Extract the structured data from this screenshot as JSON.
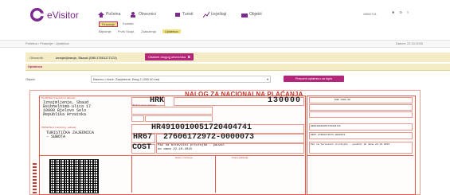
{
  "brand": {
    "name": "eVisitor",
    "color": "#7b2a8f"
  },
  "nav": {
    "items": [
      {
        "label": "Početna",
        "icon": "home-icon"
      },
      {
        "label": "Obveznici",
        "icon": "users-icon"
      },
      {
        "label": "Turisti",
        "icon": "tourist-icon"
      },
      {
        "label": "Izvještaji",
        "icon": "chart-icon"
      },
      {
        "label": "Objekti",
        "icon": "building-icon"
      }
    ],
    "subitems": [
      {
        "label": "Financije",
        "active": true
      },
      {
        "label": "Kontakt",
        "active": false
      }
    ],
    "tertiary": [
      "Biljezinje",
      "Prvih Skupl.",
      "Zaduženja",
      "Uplatnica"
    ],
    "right_code": "OIB/2721"
  },
  "breadcrumb": {
    "text": "Početna › Financije › Uplatnica",
    "right": "Datum: 22.10.2015"
  },
  "tabs": {
    "obveznik_label": "Obveznik:",
    "obveznik_value": "Iznajmljivanje, Sbaud (OIB 27661177172)",
    "change_button": "Odaberi drugog obveznika"
  },
  "section": {
    "title": "Uplatnica"
  },
  "form": {
    "objekt_label": "Objekt:",
    "objekt_value": "Biserno i more, Zavjetrene, Brug 1 (300.00 km)",
    "print_button": "Preuzmi uplatnicu za ispis"
  },
  "nalog": {
    "title": "NALOG ZA NACIONALNA PLAĆANJA",
    "platitelj_label": "PLATITELJ (naziv/ime i adresa):",
    "platitelj_lines": [
      "Iznajmljenje, Sbaud",
      "Bsibnelnima ulica 17",
      "10000 Bjelovo Selo",
      "Republika Hrvatska"
    ],
    "currency": "HRK",
    "amount": "130000",
    "iban_platitelja_label": "IBAN ili račun platitelja",
    "primatelj_label": "PRIMATELJ (naziv/ime i adresa):",
    "primatelj_lines": [
      "TURISTIČKA ZAJEDNICA",
      "- SUBOTA"
    ],
    "iban_primatelja": "HR4910010051720404741",
    "model": "HR67",
    "poziv_na_broj": "27606172972-0000073",
    "sifra_namjene": "COST",
    "opis_placanja": "Paz na boravišni pristojbe - pauzal do dana 22.10.2015",
    "datum_izvrsenja_label": "Datum izvršenja",
    "potpis_label": "Potpis platitelja",
    "stub_amount": "EUR 1300,00",
    "stub_iban": "HR4910010051720404741",
    "stub_poziv": "HR67 27606172972-0000073",
    "stub_opis": "Paz na boravišni pristojbe - paushal do dana 22.10.2015"
  },
  "colors": {
    "accent": "#b5267a",
    "form_red": "#e25a4a",
    "tab_bg": "#f3ecc6"
  }
}
